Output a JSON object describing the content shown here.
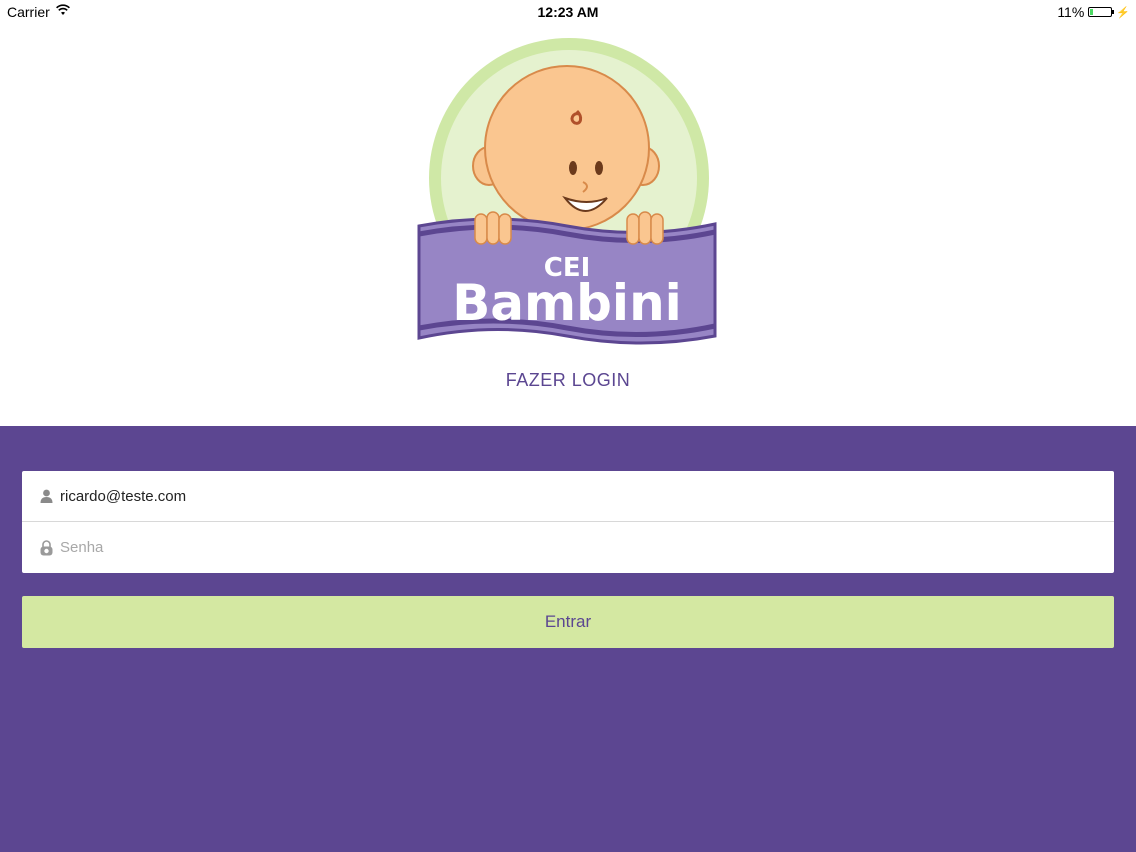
{
  "status_bar": {
    "carrier": "Carrier",
    "time": "12:23 AM",
    "battery_percent": "11%",
    "battery_level": 0.11
  },
  "logo": {
    "line1": "CEI",
    "line2": "Bambini"
  },
  "login": {
    "heading": "FAZER LOGIN",
    "email_value": "ricardo@teste.com",
    "password_placeholder": "Senha",
    "submit_label": "Entrar"
  },
  "colors": {
    "brand_purple": "#5c4691",
    "button_green": "#d4e8a2",
    "logo_green": "#cde8a6"
  },
  "icons": {
    "email": "user-icon",
    "password": "lock-icon"
  }
}
